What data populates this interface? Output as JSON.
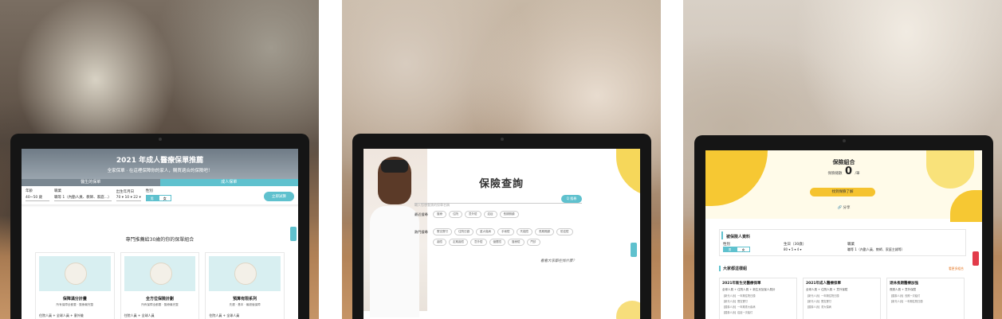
{
  "screen1": {
    "hero_title": "2021 年成人醫療保單推薦",
    "hero_subtitle": "全家保單 · 在這裡保障你的家人，購買適合的保險吧！",
    "tab_a": "醫生的保單",
    "tab_b": "成人保單",
    "form": {
      "age_label": "年齡",
      "age_value": "40~50 歲",
      "job_label": "職業",
      "job_value": "職等 1（內勤人員、教師、家庭...）",
      "birthday_label": "出生年月日",
      "birthday_value": "70  ▾  10  ▾  22  ▾",
      "gender_label": "性別",
      "gender_options": [
        "男",
        "女"
      ],
      "submit_label": "立即試算"
    },
    "section_title": "專門推薦給30歲的你的保單組合",
    "cards": [
      {
        "title": "保障滿分計畫",
        "sub": "所有保障全都要 · 醫療最完整",
        "foot": "住院人員 + 全球人員 + 意外險"
      },
      {
        "title": "全方位保險計劃",
        "sub": "所有保障全都要 · 醫療最完整",
        "foot": "住院人員 + 全球人員"
      },
      {
        "title": "預算有限系列",
        "sub": "先選 · 基本 · 最超值保障",
        "foot": "住院人員 + 全球人員"
      }
    ]
  },
  "screen2": {
    "title": "保險查詢",
    "search_placeholder": "輸入您想查詢的保單名稱",
    "search_button": "Q 搜尋",
    "recent_label": "最近搜尋",
    "recent_chips": [
      "醫療",
      "住院",
      "意外險",
      "癌症",
      "長期照顧"
    ],
    "popular_label": "熱門搜尋",
    "popular_row1": [
      "實支實付",
      "住院日額",
      "重大傷病",
      "手術險",
      "失能險",
      "長期照顧",
      "防癌險"
    ],
    "popular_row2": [
      "壽險",
      "定期壽險",
      "意外險",
      "儲蓄險",
      "醫療險",
      "門診"
    ],
    "note": "看看大家都在找什麼？"
  },
  "screen3": {
    "title": "保險組合",
    "count_prefix": "保險總數",
    "count_value": "0",
    "count_suffix": "/筆",
    "main_button": "找到保險了解",
    "share_label": "分享",
    "form_title": "被保險人資料",
    "gender_label": "性別",
    "gender_options": [
      "男",
      "女"
    ],
    "birthday_label": "生日（30歲）",
    "birthday_value": "80  ▾  5  ▾  4  ▾",
    "job_label": "職業",
    "job_value": "職等 1（內勤人員、教師、家庭主婦等）",
    "section_title": "大家都這樣組",
    "more_label": "看更多組合",
    "cards": [
      {
        "title": "2021年新生兒醫療保單",
        "sub": "全球人員 + 住院人員 + 新生兒加保人員計",
        "lines": [
          "【新光人壽】一年期住院日額",
          "【新光人壽】實支實付",
          "【國泰人壽】一年期重大疾病",
          "【國泰人壽】癌症一次給付"
        ]
      },
      {
        "title": "2021年成人醫療保單",
        "sub": "全球人員 + 住院人員 + 意外保險",
        "lines": [
          "【新光人壽】一年期住院日額",
          "【新光人壽】實支實付",
          "【國泰人壽】重大傷病"
        ]
      },
      {
        "title": "退休長期醫療加強",
        "sub": "長照人員 + 意外保險",
        "lines": [
          "【國泰人壽】長照一次給付",
          "【新光人壽】一年期住院日額"
        ]
      }
    ]
  }
}
